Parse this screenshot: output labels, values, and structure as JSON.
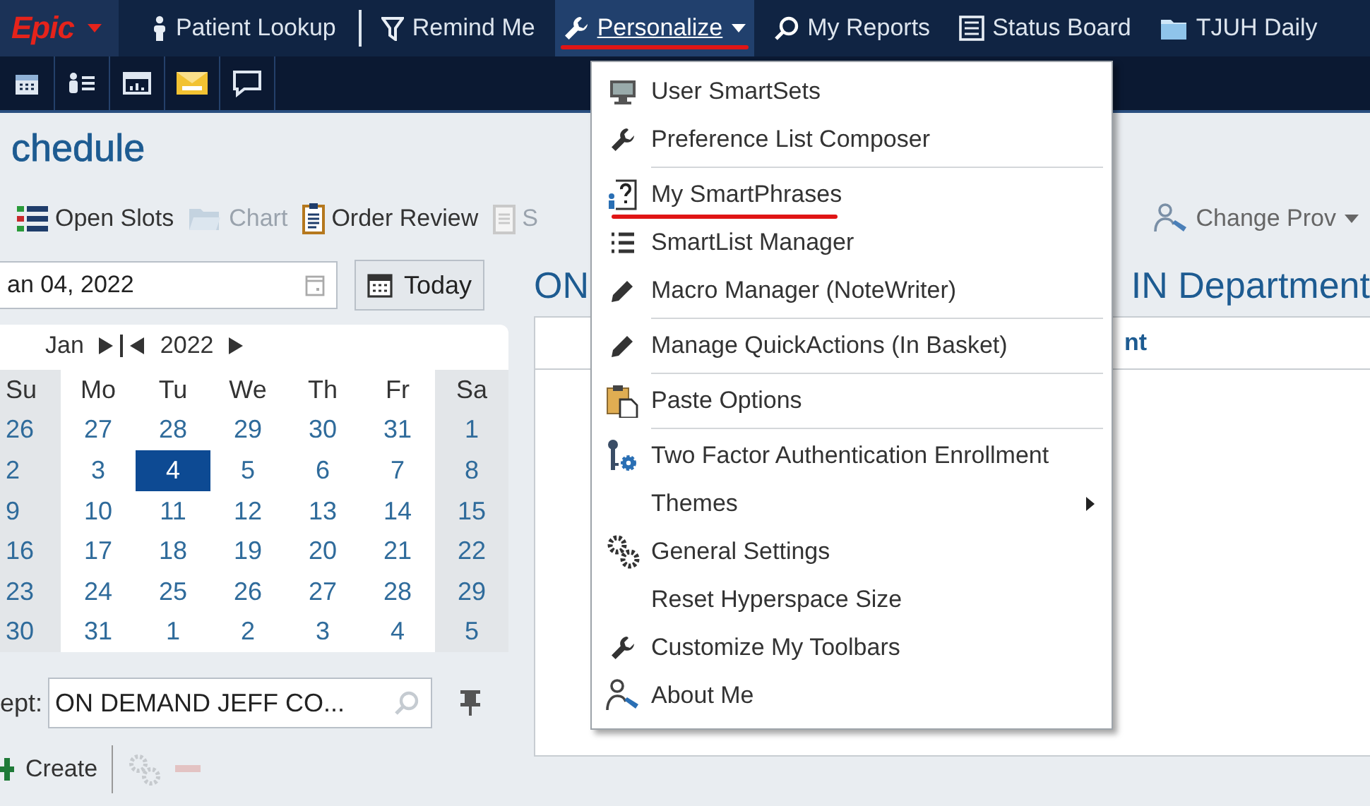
{
  "topbar": {
    "logo": "Epic",
    "items": [
      {
        "label": "Patient Lookup",
        "selected": false,
        "has_dropdown": false,
        "annotated": false
      },
      {
        "label": "Remind Me",
        "selected": false,
        "has_dropdown": false,
        "annotated": false
      },
      {
        "label": "Personalize",
        "selected": true,
        "has_dropdown": true,
        "annotated": true
      },
      {
        "label": "My Reports",
        "selected": false,
        "has_dropdown": false,
        "annotated": false
      },
      {
        "label": "Status Board",
        "selected": false,
        "has_dropdown": false,
        "annotated": false
      },
      {
        "label": "TJUH Daily",
        "selected": false,
        "has_dropdown": false,
        "annotated": false
      }
    ]
  },
  "page_title": "chedule",
  "actions": [
    {
      "label": "Open Slots",
      "disabled": false
    },
    {
      "label": "Chart",
      "disabled": true
    },
    {
      "label": "Order Review",
      "disabled": false
    },
    {
      "label": "S",
      "disabled": true
    }
  ],
  "change_prov": {
    "label": "Change Prov"
  },
  "date_field": {
    "value": "an 04, 2022"
  },
  "today_button": {
    "label": "Today"
  },
  "calendar": {
    "month": "Jan",
    "year": "2022",
    "weekdays": [
      "Su",
      "Mo",
      "Tu",
      "We",
      "Th",
      "Fr",
      "Sa"
    ],
    "weeks": [
      [
        {
          "day": "26",
          "selected": false
        },
        {
          "day": "27",
          "selected": false
        },
        {
          "day": "28",
          "selected": false
        },
        {
          "day": "29",
          "selected": false
        },
        {
          "day": "30",
          "selected": false
        },
        {
          "day": "31",
          "selected": false
        },
        {
          "day": "1",
          "selected": false
        }
      ],
      [
        {
          "day": "2",
          "selected": false
        },
        {
          "day": "3",
          "selected": false
        },
        {
          "day": "4",
          "selected": true
        },
        {
          "day": "5",
          "selected": false
        },
        {
          "day": "6",
          "selected": false
        },
        {
          "day": "7",
          "selected": false
        },
        {
          "day": "8",
          "selected": false
        }
      ],
      [
        {
          "day": "9",
          "selected": false
        },
        {
          "day": "10",
          "selected": false
        },
        {
          "day": "11",
          "selected": false
        },
        {
          "day": "12",
          "selected": false
        },
        {
          "day": "13",
          "selected": false
        },
        {
          "day": "14",
          "selected": false
        },
        {
          "day": "15",
          "selected": false
        }
      ],
      [
        {
          "day": "16",
          "selected": false
        },
        {
          "day": "17",
          "selected": false
        },
        {
          "day": "18",
          "selected": false
        },
        {
          "day": "19",
          "selected": false
        },
        {
          "day": "20",
          "selected": false
        },
        {
          "day": "21",
          "selected": false
        },
        {
          "day": "22",
          "selected": false
        }
      ],
      [
        {
          "day": "23",
          "selected": false
        },
        {
          "day": "24",
          "selected": false
        },
        {
          "day": "25",
          "selected": false
        },
        {
          "day": "26",
          "selected": false
        },
        {
          "day": "27",
          "selected": false
        },
        {
          "day": "28",
          "selected": false
        },
        {
          "day": "29",
          "selected": false
        }
      ],
      [
        {
          "day": "30",
          "selected": false
        },
        {
          "day": "31",
          "selected": false
        },
        {
          "day": "1",
          "selected": false
        },
        {
          "day": "2",
          "selected": false
        },
        {
          "day": "3",
          "selected": false
        },
        {
          "day": "4",
          "selected": false
        },
        {
          "day": "5",
          "selected": false
        }
      ]
    ]
  },
  "dept": {
    "label": "ept:",
    "value": "ON DEMAND JEFF CO..."
  },
  "create_button": {
    "label": "Create"
  },
  "heading_left": "ON",
  "heading_right": "IN Department",
  "table": {
    "columns": [
      "nt"
    ]
  },
  "menu": {
    "items": [
      {
        "label": "User SmartSets",
        "divider_above": false,
        "submenu": false,
        "annotated": false
      },
      {
        "label": "Preference List Composer",
        "divider_above": false,
        "submenu": false,
        "annotated": false
      },
      {
        "label": "My SmartPhrases",
        "divider_above": true,
        "submenu": false,
        "annotated": true
      },
      {
        "label": "SmartList Manager",
        "divider_above": false,
        "submenu": false,
        "annotated": false
      },
      {
        "label": "Macro Manager (NoteWriter)",
        "divider_above": false,
        "submenu": false,
        "annotated": false
      },
      {
        "label": "Manage QuickActions (In Basket)",
        "divider_above": true,
        "submenu": false,
        "annotated": false
      },
      {
        "label": "Paste Options",
        "divider_above": true,
        "submenu": false,
        "annotated": false
      },
      {
        "label": "Two Factor Authentication Enrollment",
        "divider_above": true,
        "submenu": false,
        "annotated": false
      },
      {
        "label": "Themes",
        "divider_above": false,
        "submenu": true,
        "annotated": false
      },
      {
        "label": "General Settings",
        "divider_above": false,
        "submenu": false,
        "annotated": false
      },
      {
        "label": "Reset Hyperspace Size",
        "divider_above": false,
        "submenu": false,
        "annotated": false
      },
      {
        "label": "Customize My Toolbars",
        "divider_above": false,
        "submenu": false,
        "annotated": false
      },
      {
        "label": "About Me",
        "divider_above": false,
        "submenu": false,
        "annotated": false
      }
    ]
  }
}
